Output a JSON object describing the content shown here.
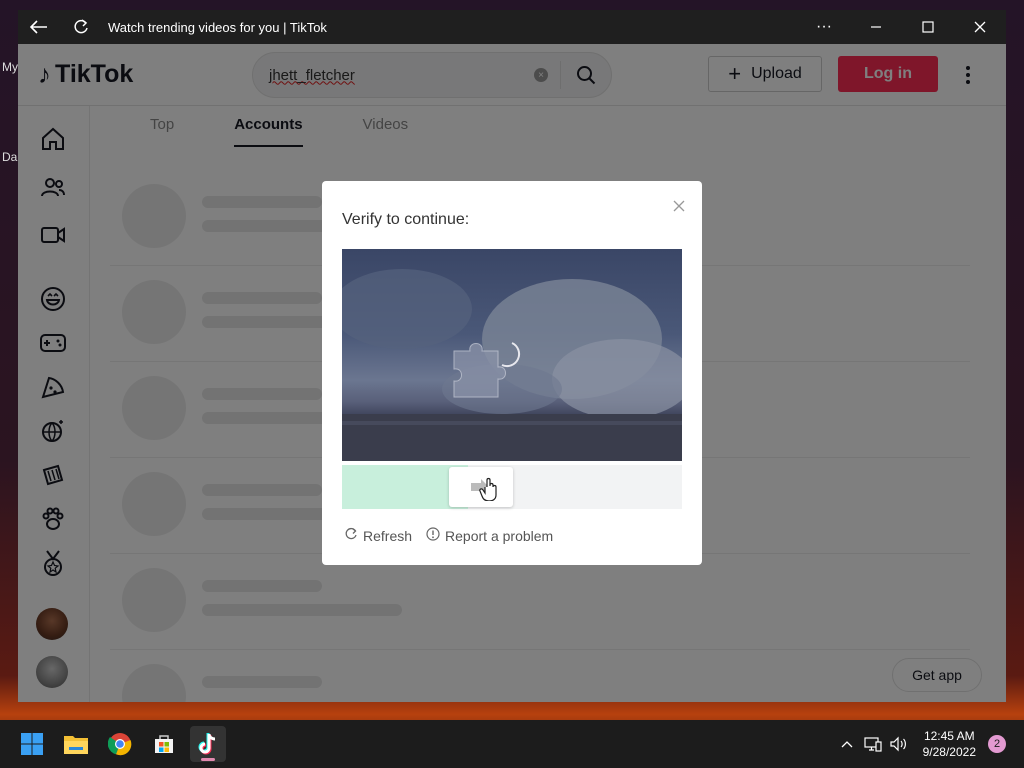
{
  "desktop": {
    "label1": "My",
    "label2": "Da"
  },
  "window": {
    "title": "Watch trending videos for you | TikTok",
    "back_icon": "arrow-left-icon",
    "refresh_icon": "reload-icon",
    "more_icon": "ellipsis-icon"
  },
  "header": {
    "logo_text": "TikTok",
    "search": {
      "value": "jhett_fletcher",
      "clear_icon": "clear-icon",
      "search_icon": "search-icon"
    },
    "upload_label": "Upload",
    "login_label": "Log in"
  },
  "tabs": [
    {
      "label": "Top",
      "active": false
    },
    {
      "label": "Accounts",
      "active": true
    },
    {
      "label": "Videos",
      "active": false
    }
  ],
  "sidebar": {
    "icons": [
      "home-icon",
      "following-icon",
      "live-icon",
      "comedy-icon",
      "gaming-icon",
      "food-icon",
      "dance-icon",
      "beauty-icon",
      "animals-icon",
      "sports-icon"
    ]
  },
  "get_app_label": "Get app",
  "captcha": {
    "title": "Verify to continue:",
    "slider_progress": 0.37,
    "refresh_label": "Refresh",
    "report_label": "Report a problem"
  },
  "taskbar": {
    "apps": [
      "windows-start-icon",
      "file-explorer-icon",
      "chrome-icon",
      "microsoft-store-icon",
      "tiktok-icon"
    ],
    "time": "12:45 AM",
    "date": "9/28/2022",
    "notification_count": "2"
  }
}
